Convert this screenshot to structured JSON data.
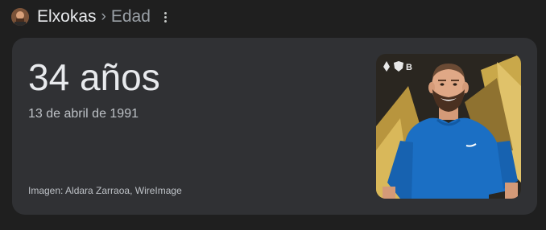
{
  "header": {
    "entity": "Elxokas",
    "separator": "›",
    "attribute": "Edad",
    "avatar_icon": "person-avatar",
    "more_icon": "three-dots-vertical-icon"
  },
  "answer": {
    "age": "34 años",
    "birth_date": "13 de abril de 1991",
    "image_credit": "Imagen: Aldara Zarraoa, WireImage"
  },
  "photo": {
    "subject_icon": "person-photo",
    "background_logos": [
      "♠",
      "B"
    ]
  },
  "colors": {
    "page_background": "#1f1f1f",
    "card_background": "#303134",
    "primary_text": "#e8eaed",
    "secondary_text": "#bdc1c6",
    "shirt_blue": "#1b6fc4",
    "gold": "#c9a84a"
  }
}
